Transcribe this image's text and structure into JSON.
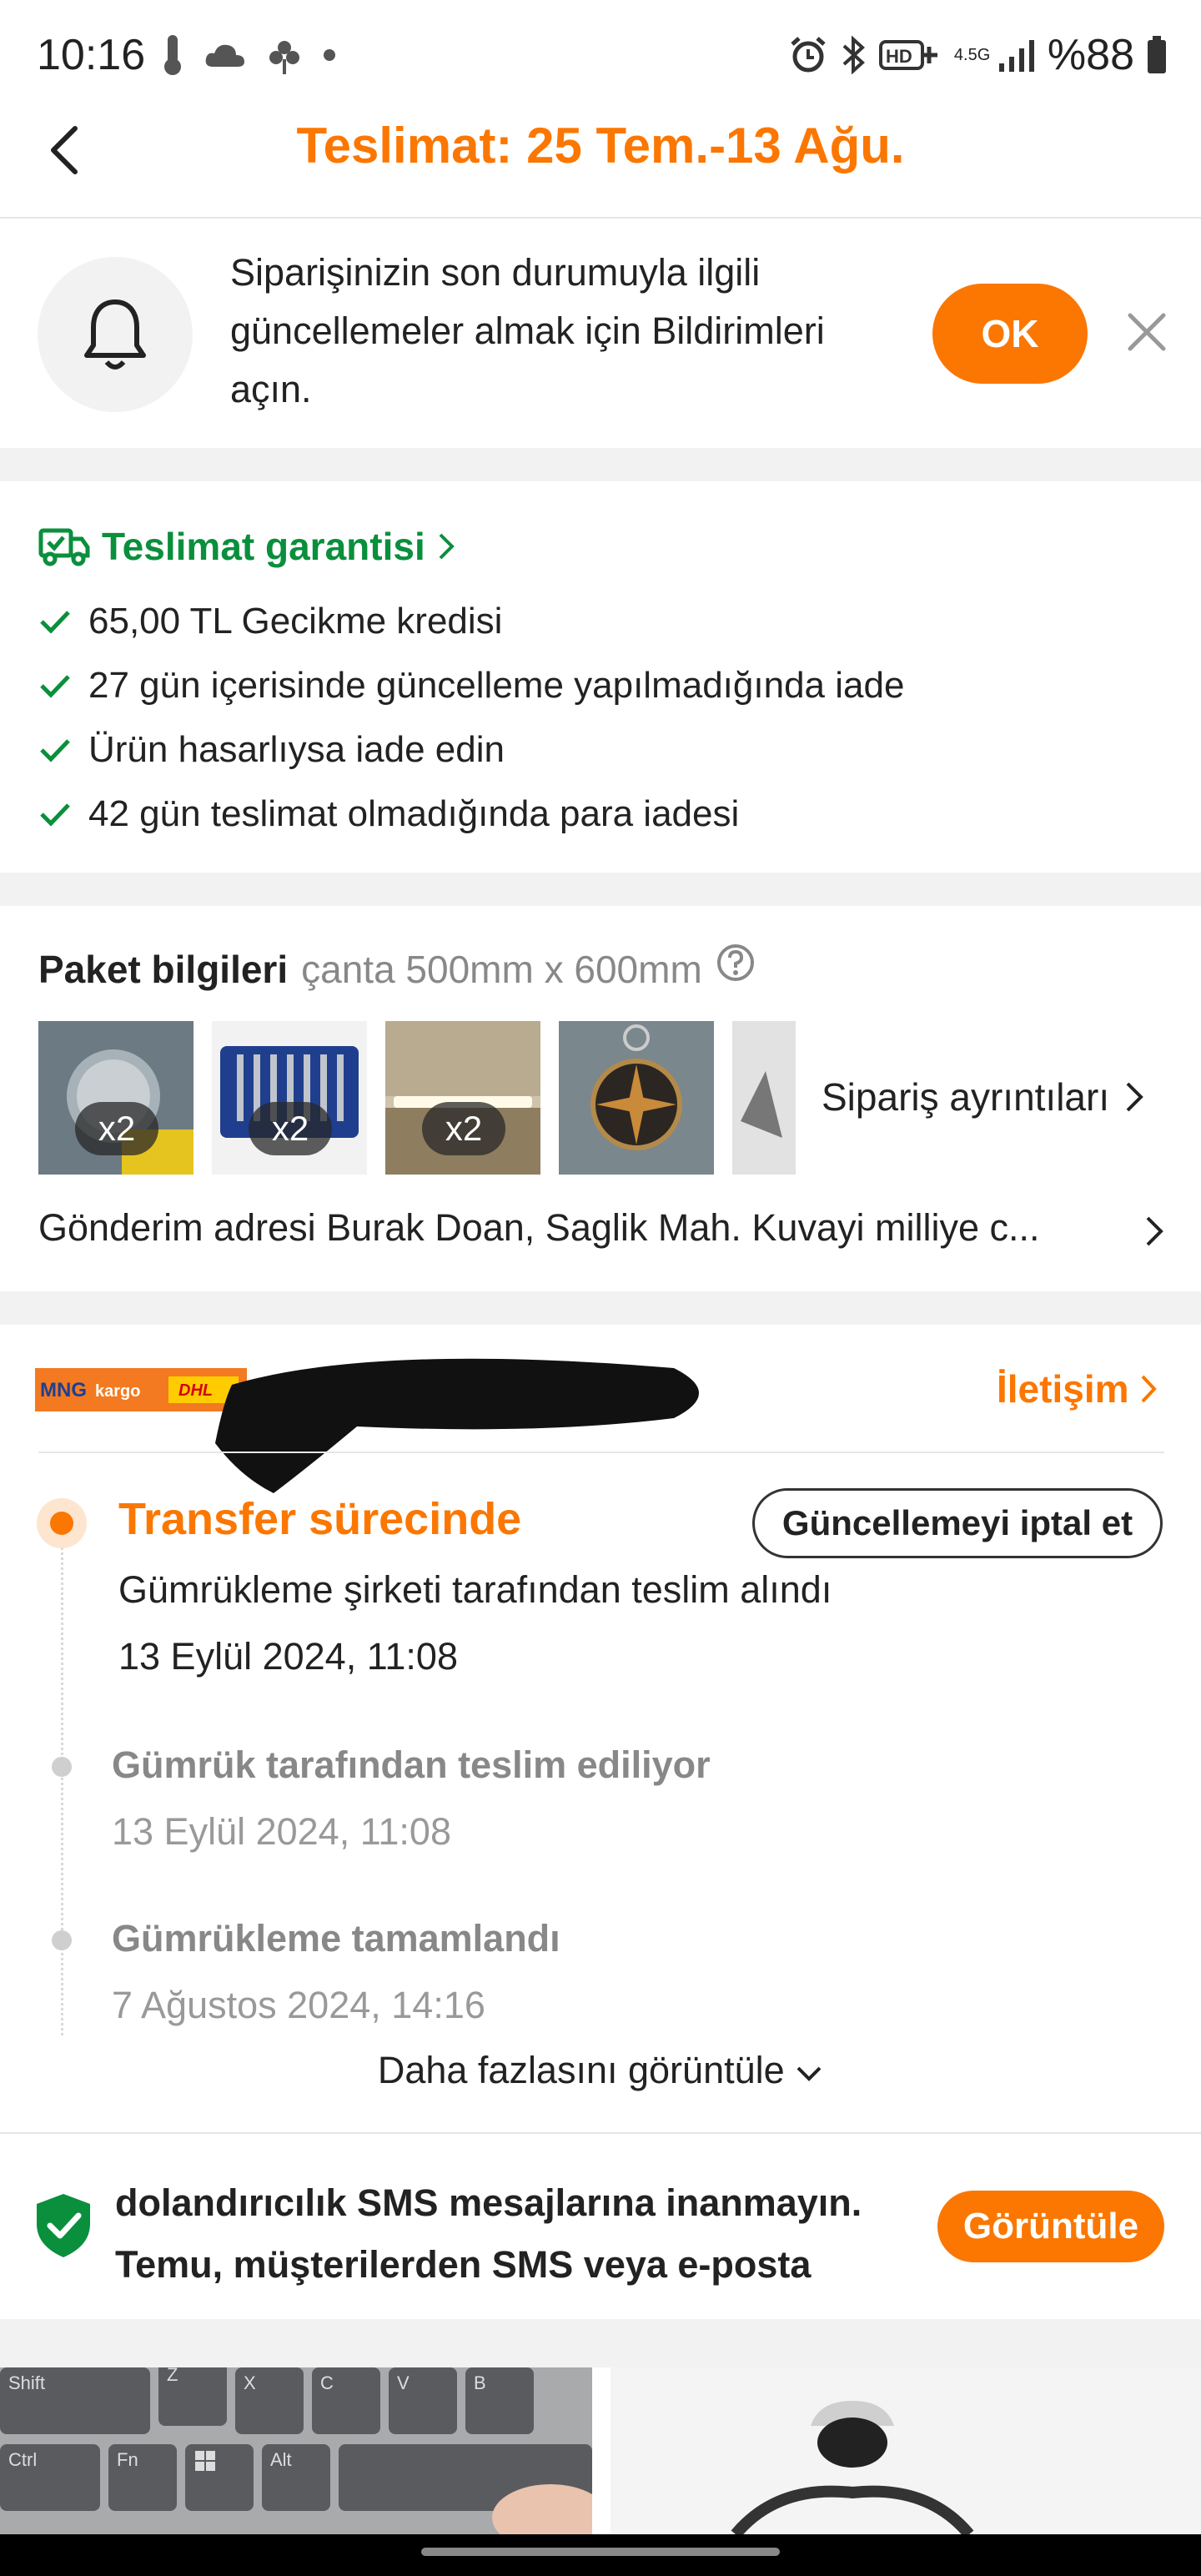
{
  "status_bar": {
    "time": "10:16",
    "battery": "%88",
    "network": "4.5G"
  },
  "header": {
    "title": "Teslimat: 25 Tem.-13 Ağu."
  },
  "notification": {
    "text": "Siparişinizin son durumuyla ilgili güncellemeler almak için Bildirimleri açın.",
    "ok_label": "OK"
  },
  "guarantee": {
    "title": "Teslimat garantisi",
    "items": [
      "65,00 TL Gecikme kredisi",
      "27 gün içerisinde güncelleme yapılmadığında iade",
      "Ürün hasarlıysa iade edin",
      "42 gün teslimat olmadığında para iadesi"
    ]
  },
  "package": {
    "title": "Paket bilgileri",
    "subtitle": "çanta 500mm x 600mm",
    "thumbnails": [
      {
        "qty": "x2",
        "icon": "product-image"
      },
      {
        "qty": "x2",
        "icon": "product-image"
      },
      {
        "qty": "x2",
        "icon": "product-image"
      },
      {
        "qty": "",
        "icon": "product-image"
      },
      {
        "qty": "",
        "icon": "product-image"
      }
    ],
    "details_label": "Sipariş ayrıntıları",
    "address_label": "Gönderim adresi",
    "address_value": "Burak Doan, Saglik Mah. Kuvayi milliye c..."
  },
  "courier": {
    "logo_text": "MNG kargo DHL",
    "contact_label": "İletişim"
  },
  "tracking": {
    "current_status": "Transfer sürecinde",
    "cancel_label": "Güncellemeyi iptal et",
    "current_detail": "Gümrükleme şirketi tarafından teslim alındı",
    "current_date": "13 Eylül 2024, 11:08",
    "events": [
      {
        "title": "Gümrük tarafından teslim ediliyor",
        "date": "13 Eylül 2024, 11:08"
      },
      {
        "title": "Gümrükleme tamamlandı",
        "date": "7 Ağustos 2024, 14:16"
      }
    ],
    "more_label": "Daha fazlasını görüntüle"
  },
  "sms_warning": {
    "text": "dolandırıcılık SMS mesajlarına inanmayın. Temu, müşterilerden SMS veya e-posta",
    "button_label": "Görüntüle"
  },
  "keyboard_keys": [
    "Shift",
    "Z",
    "X",
    "C",
    "V",
    "B",
    "Ctrl",
    "Fn",
    "Alt"
  ],
  "colors": {
    "accent": "#fb7701",
    "success": "#0a8f3c",
    "divider": "#f2f2f2"
  }
}
